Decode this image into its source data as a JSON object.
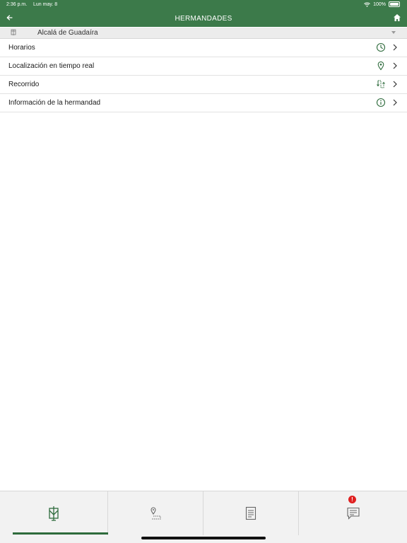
{
  "status": {
    "time": "2:36 p.m.",
    "date": "Lun may. 8",
    "battery": "100%"
  },
  "navbar": {
    "title": "HERMANDADES",
    "back_icon": "arrow-left-icon",
    "home_icon": "home-icon"
  },
  "selector": {
    "value": "Alcalá de Guadaíra",
    "icon": "brotherhood-icon"
  },
  "menu": [
    {
      "label": "Horarios",
      "icon": "clock-icon"
    },
    {
      "label": "Localización en tiempo real",
      "icon": "location-pin-icon"
    },
    {
      "label": "Recorrido",
      "icon": "route-icon"
    },
    {
      "label": "Información de la hermandad",
      "icon": "info-icon"
    }
  ],
  "tabbar": {
    "tabs": [
      {
        "icon": "brotherhood-icon",
        "active": true
      },
      {
        "icon": "map-route-icon",
        "active": false
      },
      {
        "icon": "document-icon",
        "active": false
      },
      {
        "icon": "chat-icon",
        "active": false
      }
    ],
    "badge": "!"
  },
  "colors": {
    "header": "#3c7a4a",
    "accent": "#2e6b3c",
    "badge": "#e02020"
  }
}
